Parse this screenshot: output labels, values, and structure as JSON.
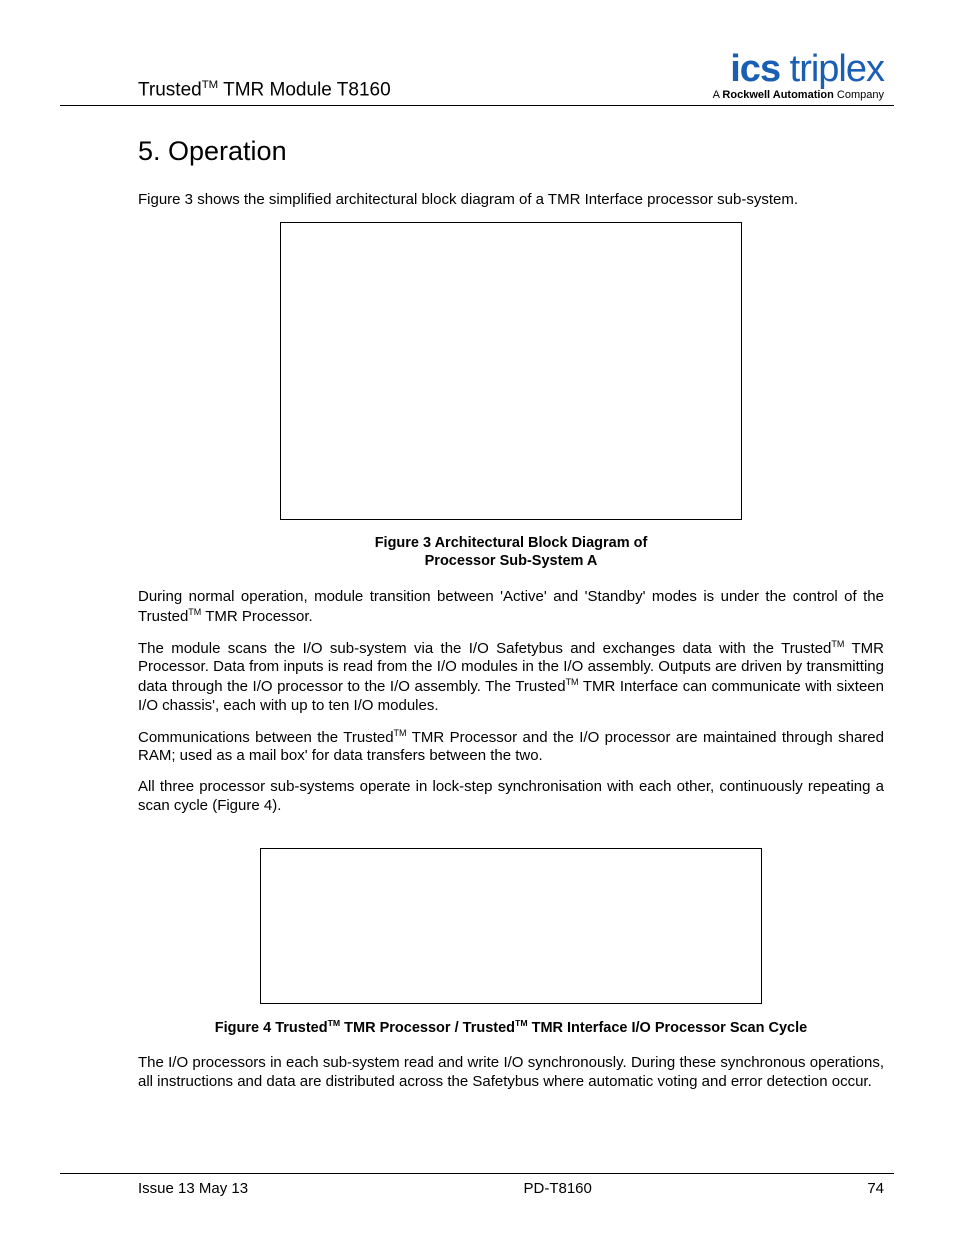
{
  "header": {
    "product_prefix": "Trusted",
    "tm": "TM",
    "product_suffix": " TMR Module T8160",
    "logo_ics": "ics",
    "logo_triplex": " triplex",
    "logo_sub_a": "A ",
    "logo_sub_ra": "Rockwell Automation",
    "logo_sub_co": " Company"
  },
  "section": {
    "heading": "5.   Operation",
    "intro": "Figure 3 shows the simplified architectural block diagram of a TMR Interface processor sub-system.",
    "fig3_caption_l1": "Figure 3 Architectural Block Diagram of",
    "fig3_caption_l2": "Processor Sub-System A",
    "p1_a": "During normal operation, module transition between 'Active' and 'Standby' modes is under the control of the Trusted",
    "p1_b": " TMR Processor.",
    "p2_a": "The module scans the I/O sub-system via the I/O Safetybus and exchanges data with the Trusted",
    "p2_b": " TMR Processor.  Data from inputs is read from the I/O modules in the I/O assembly.  Outputs are driven by transmitting data through the I/O processor to the I/O assembly.  The Trusted",
    "p2_c": " TMR Interface can communicate with sixteen I/O chassis', each with up to ten I/O modules.",
    "p3_a": "Communications between the Trusted",
    "p3_b": " TMR Processor and the I/O processor are maintained through shared RAM; used as a mail box' for data transfers between the two.",
    "p4": "All three processor sub-systems operate in lock-step synchronisation with each other, continuously repeating a scan cycle (Figure 4).",
    "fig4_a": "Figure 4 Trusted",
    "fig4_b": " TMR Processor / Trusted",
    "fig4_c": " TMR Interface I/O Processor Scan Cycle",
    "p5": "The I/O processors in each sub-system read and write I/O synchronously.  During these synchronous operations, all instructions and data are distributed across the Safetybus where automatic voting and error detection occur."
  },
  "footer": {
    "left": "Issue 13 May 13",
    "center": "PD-T8160",
    "right": "74"
  }
}
